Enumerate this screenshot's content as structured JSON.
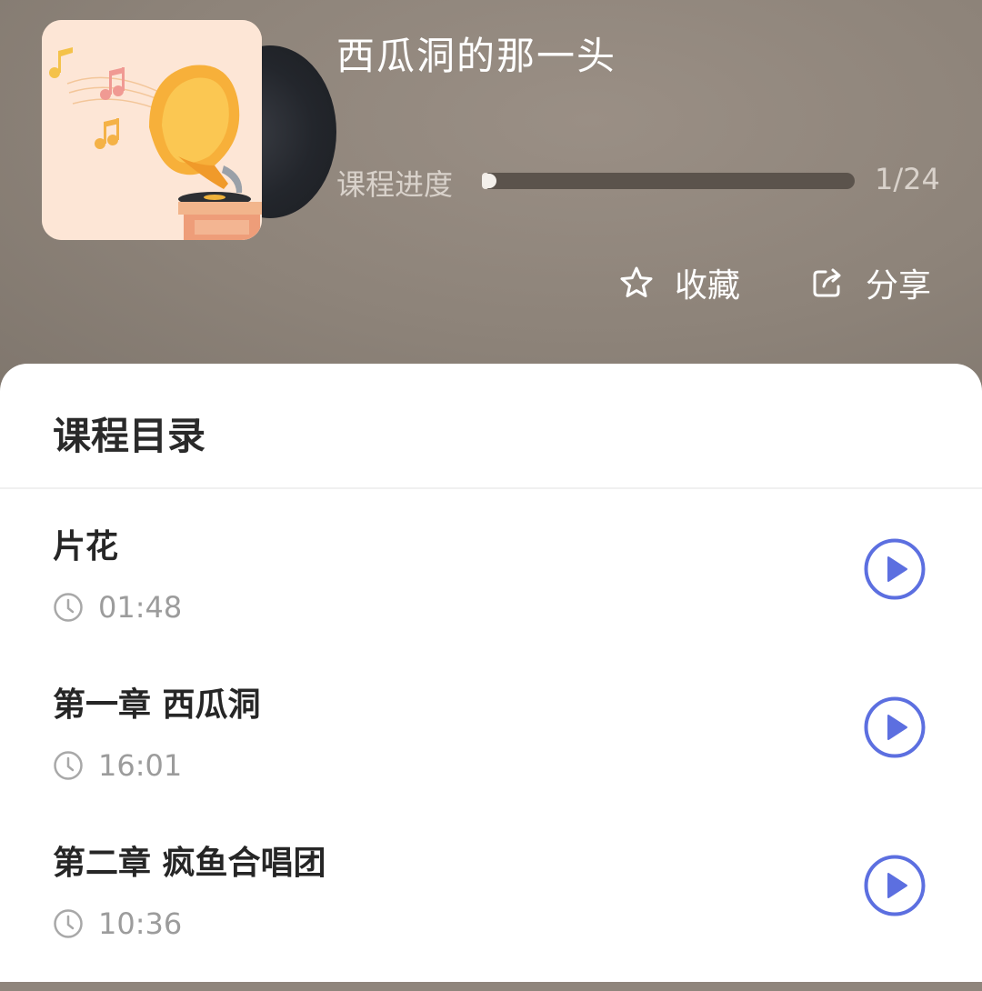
{
  "header": {
    "title": "西瓜洞的那一头",
    "progress": {
      "label": "课程进度",
      "current": 1,
      "total": 24,
      "count_text": "1/24"
    },
    "actions": {
      "favorite": {
        "label": "收藏",
        "icon": "star-outline-icon"
      },
      "share": {
        "label": "分享",
        "icon": "share-icon"
      }
    },
    "cover": {
      "icon": "gramophone-music-illustration"
    }
  },
  "catalog": {
    "title": "课程目录",
    "lessons": [
      {
        "title": "片花",
        "duration": "01:48"
      },
      {
        "title": "第一章 西瓜洞",
        "duration": "16:01"
      },
      {
        "title": "第二章 疯鱼合唱团",
        "duration": "10:36"
      }
    ]
  },
  "colors": {
    "accent_play": "#5c6fe0",
    "header_bg": "#8f857c",
    "progress_track": "#5b534c"
  }
}
